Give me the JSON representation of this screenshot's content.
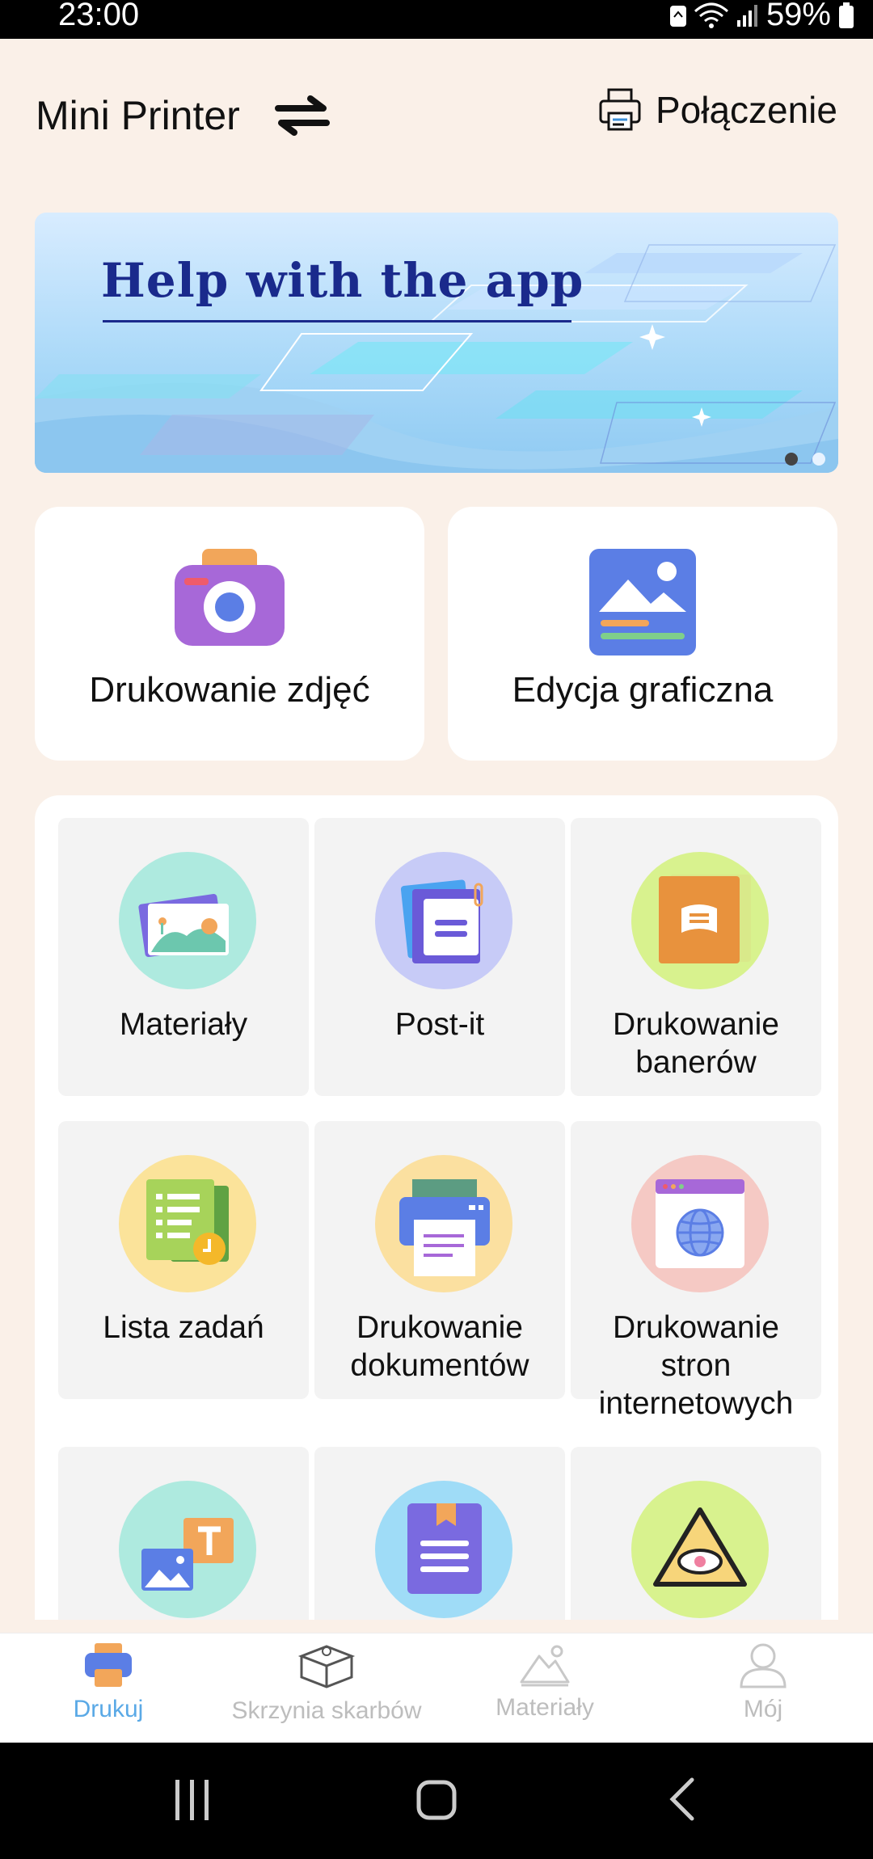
{
  "status_bar": {
    "time": "23:00",
    "battery": "59%"
  },
  "header": {
    "title": "Mini Printer",
    "connection_label": "Połączenie"
  },
  "banner": {
    "title": "Help with the app",
    "pages": 2,
    "active_page": 1
  },
  "quick_actions": [
    {
      "label": "Drukowanie zdjęć",
      "icon": "camera-icon"
    },
    {
      "label": "Edycja graficzna",
      "icon": "image-edit-icon"
    }
  ],
  "grid": [
    {
      "line1": "Materiały",
      "line2": "",
      "line3": "",
      "icon": "materials-icon"
    },
    {
      "line1": "Post-it",
      "line2": "",
      "line3": "",
      "icon": "sticky-note-icon"
    },
    {
      "line1": "Drukowanie",
      "line2": "banerów",
      "line3": "",
      "icon": "banner-icon"
    },
    {
      "line1": "Lista zadań",
      "line2": "",
      "line3": "",
      "icon": "task-list-icon"
    },
    {
      "line1": "Drukowanie",
      "line2": "dokumentów",
      "line3": "",
      "icon": "printer-document-icon"
    },
    {
      "line1": "Drukowanie",
      "line2": "stron",
      "line3": "internetowych",
      "icon": "globe-browser-icon"
    },
    {
      "line1": "",
      "line2": "",
      "line3": "",
      "icon": "image-text-icon"
    },
    {
      "line1": "",
      "line2": "",
      "line3": "",
      "icon": "bookmark-doc-icon"
    },
    {
      "line1": "",
      "line2": "",
      "line3": "",
      "icon": "eye-triangle-icon"
    }
  ],
  "bottom_nav": [
    {
      "label": "Drukuj",
      "icon": "printer-icon",
      "active": true
    },
    {
      "label": "Skrzynia skarbów",
      "icon": "treasure-box-icon",
      "active": false
    },
    {
      "label": "Materiały",
      "icon": "mountain-icon",
      "active": false
    },
    {
      "label": "Mój",
      "icon": "user-icon",
      "active": false
    }
  ],
  "colors": {
    "accent": "#5aa9e6",
    "background": "#faf0e8",
    "banner_text": "#1a2a8c"
  }
}
